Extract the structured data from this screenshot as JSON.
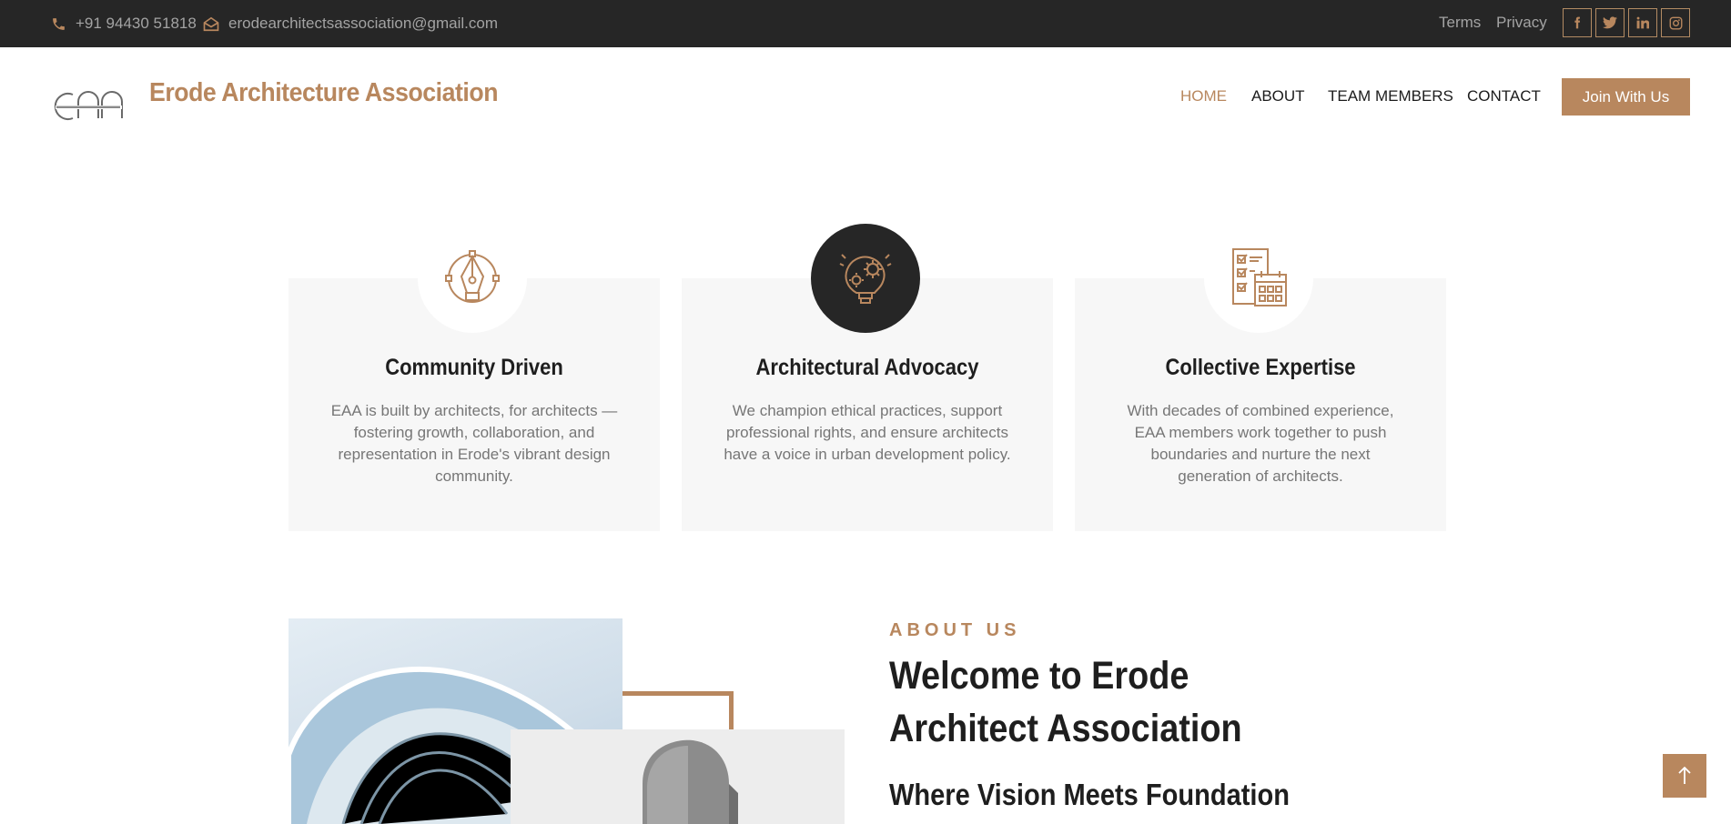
{
  "topbar": {
    "phone": "+91 94430 51818",
    "email": "erodearchitectsassociation@gmail.com",
    "links": {
      "terms": "Terms",
      "privacy": "Privacy"
    },
    "social_icons": [
      "facebook-icon",
      "twitter-icon",
      "linkedin-icon",
      "instagram-icon"
    ]
  },
  "header": {
    "brand": "Erode Architecture Association",
    "nav": {
      "home": "HOME",
      "about": "ABOUT",
      "team": "TEAM MEMBERS",
      "contact": "CONTACT"
    },
    "active_nav": "HOME",
    "cta": "Join With Us"
  },
  "features": [
    {
      "icon": "pen-tool-icon",
      "title": "Community Driven",
      "text": "EAA is built by architects, for architects — fostering growth, collaboration, and representation in Erode's vibrant design community."
    },
    {
      "icon": "lightbulb-gears-icon",
      "title": "Architectural Advocacy",
      "text": "We champion ethical practices, support professional rights, and ensure architects have a voice in urban development policy."
    },
    {
      "icon": "checklist-calendar-icon",
      "title": "Collective Expertise",
      "text": "With decades of combined experience, EAA members work together to push boundaries and nurture the next generation of architects."
    }
  ],
  "about": {
    "eyebrow": "ABOUT US",
    "heading": "Welcome to Erode Architect Association",
    "subheading": "Where Vision Meets Foundation"
  },
  "colors": {
    "accent": "#b8875e",
    "dark": "#262626",
    "card_bg": "#f7f7f7"
  }
}
